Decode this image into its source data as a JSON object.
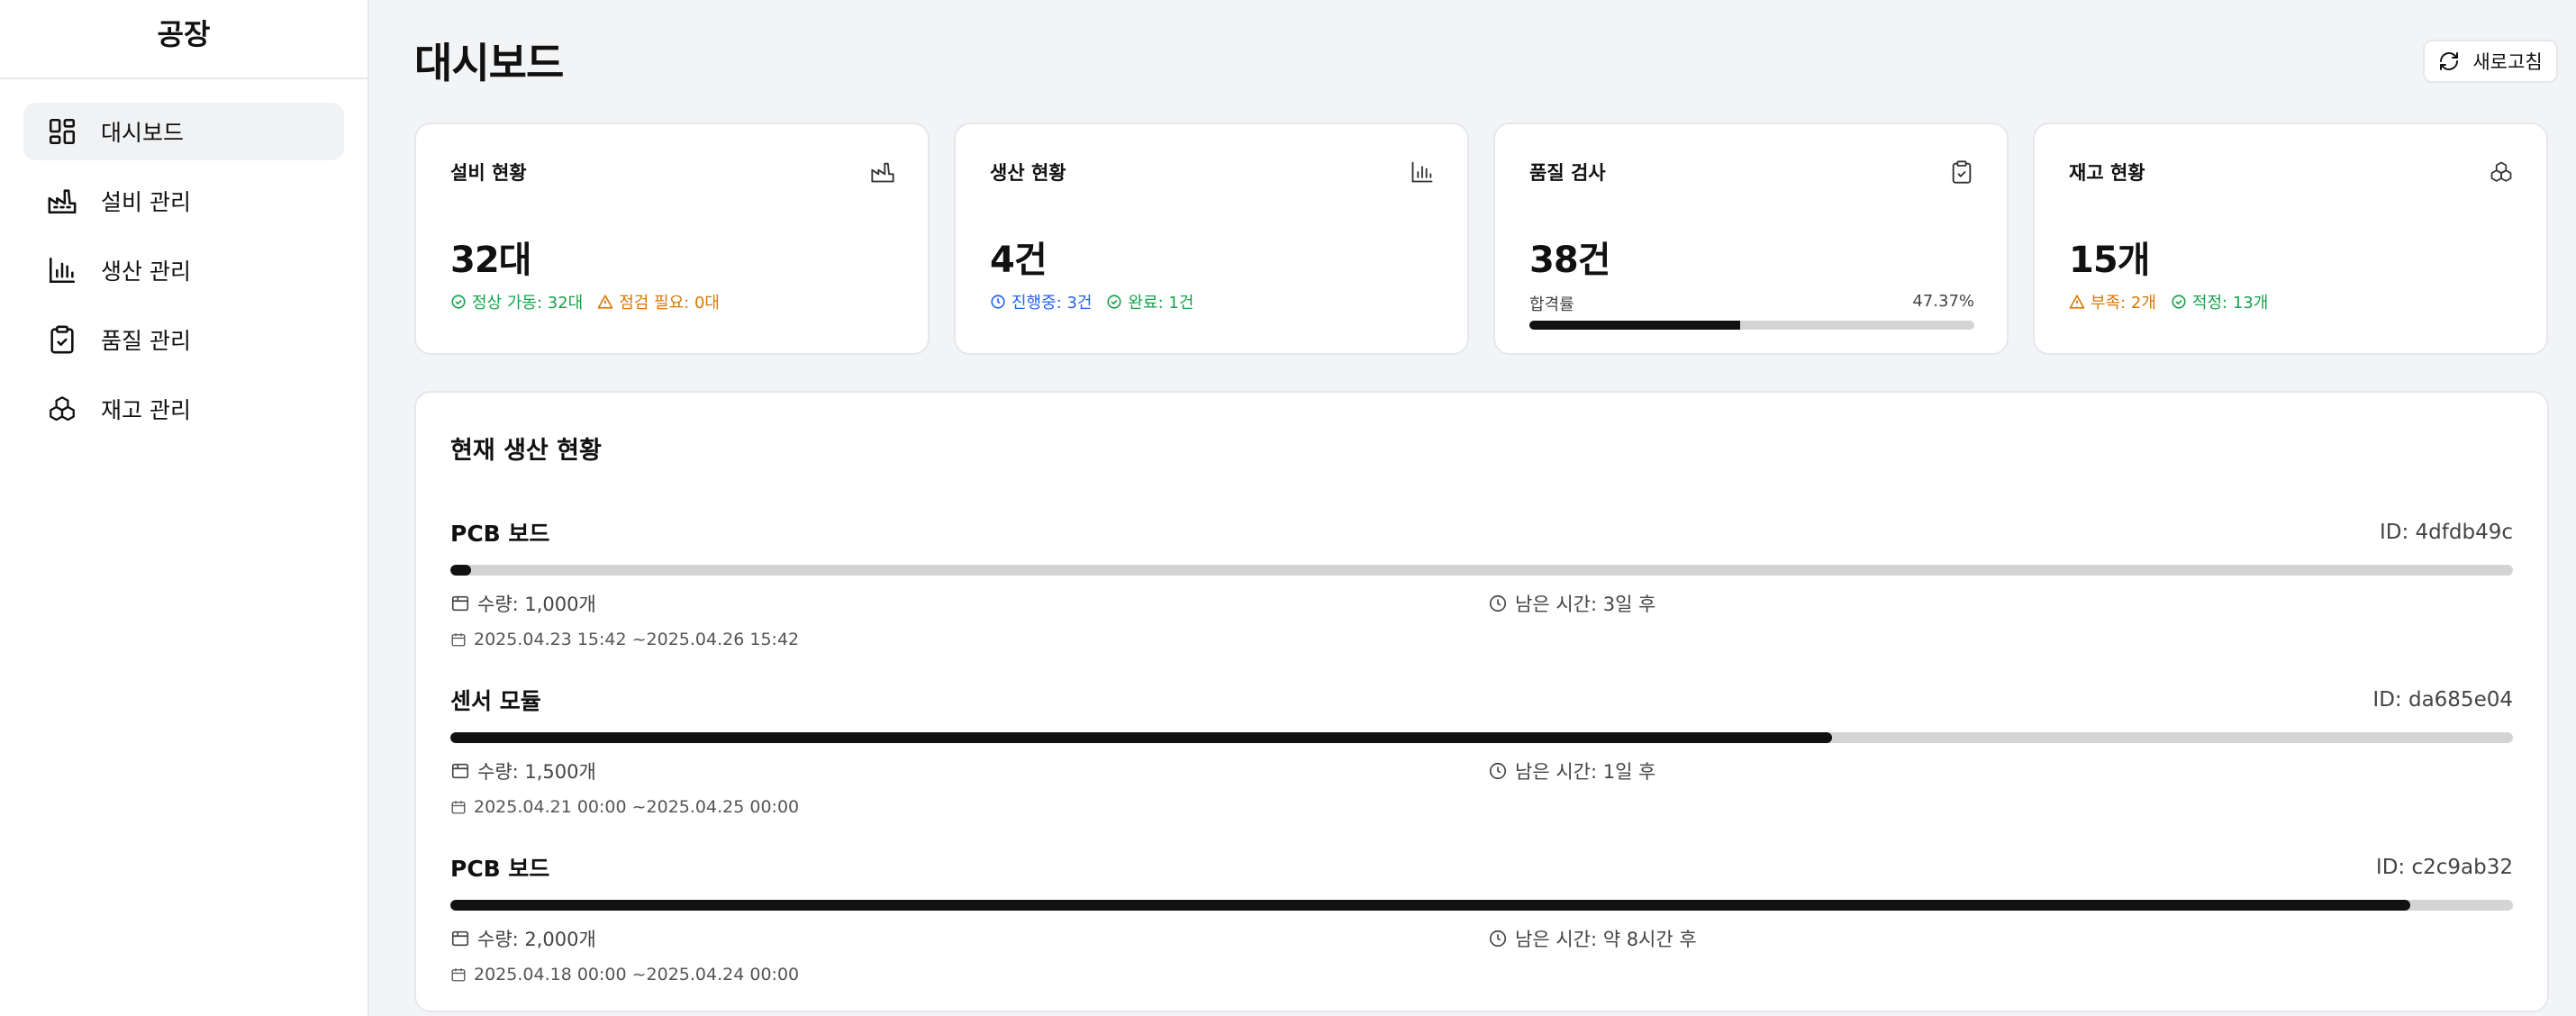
{
  "sidebar": {
    "brand": "공장",
    "items": [
      {
        "label": "대시보드",
        "icon": "dashboard-icon",
        "active": true
      },
      {
        "label": "설비 관리",
        "icon": "factory-icon",
        "active": false
      },
      {
        "label": "생산 관리",
        "icon": "bar-chart-icon",
        "active": false
      },
      {
        "label": "품질 관리",
        "icon": "clipboard-check-icon",
        "active": false
      },
      {
        "label": "재고 관리",
        "icon": "boxes-icon",
        "active": false
      }
    ]
  },
  "header": {
    "title": "대시보드",
    "refresh_label": "새로고침"
  },
  "cards": {
    "equipment": {
      "title": "설비 현황",
      "value": "32대",
      "normal": "정상 가동: 32대",
      "inspect": "점검 필요: 0대"
    },
    "production": {
      "title": "생산 현황",
      "value": "4건",
      "in_progress": "진행중: 3건",
      "done": "완료: 1건"
    },
    "quality": {
      "title": "품질 검사",
      "value": "38건",
      "rate_label": "합격률",
      "rate_text": "47.37%",
      "rate": 47.37
    },
    "inventory": {
      "title": "재고 현황",
      "value": "15개",
      "short": "부족: 2개",
      "proper": "적정: 13개"
    }
  },
  "current": {
    "title": "현재 생산 현황",
    "items": [
      {
        "name": "PCB 보드",
        "id": "ID: 4dfdb49c",
        "progress": 1,
        "quantity": "수량: 1,000개",
        "remaining": "남은 시간: 3일 후",
        "period": "2025.04.23 15:42 ~2025.04.26 15:42"
      },
      {
        "name": "센서 모듈",
        "id": "ID: da685e04",
        "progress": 67,
        "quantity": "수량: 1,500개",
        "remaining": "남은 시간: 1일 후",
        "period": "2025.04.21 00:00 ~2025.04.25 00:00"
      },
      {
        "name": "PCB 보드",
        "id": "ID: c2c9ab32",
        "progress": 95,
        "quantity": "수량: 2,000개",
        "remaining": "남은 시간: 약 8시간 후",
        "period": "2025.04.18 00:00 ~2025.04.24 00:00"
      }
    ]
  }
}
